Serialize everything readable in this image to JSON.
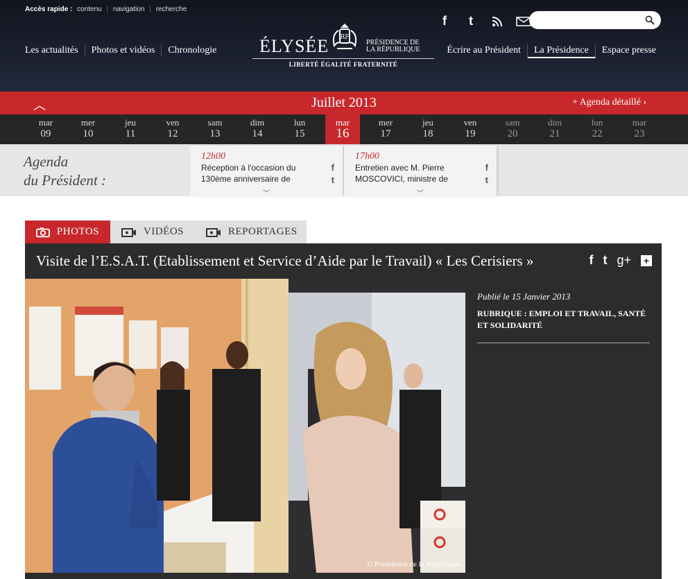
{
  "quick_access": {
    "label": "Accès rapide :",
    "links": [
      "contenu",
      "navigation",
      "recherche"
    ]
  },
  "nav_left": [
    "Les actualités",
    "Photos et vidéos",
    "Chronologie"
  ],
  "nav_right": [
    "Écrire au Président",
    "La Présidence",
    "Espace presse"
  ],
  "logo": {
    "name": "ÉLYSÉE",
    "subtitle_1": "PRÉSIDENCE DE",
    "subtitle_2": "LA RÉPUBLIQUE",
    "motto": "LIBERTÉ ÉGALITÉ FRATERNITÉ"
  },
  "social_top": [
    "facebook-icon",
    "twitter-icon",
    "rss-icon",
    "mail-icon"
  ],
  "search": {
    "value": "",
    "placeholder": ""
  },
  "calendar": {
    "month": "Juillet 2013",
    "agenda_link": "+ Agenda détaillé ›",
    "days": [
      {
        "name": "mar",
        "num": "09"
      },
      {
        "name": "mer",
        "num": "10"
      },
      {
        "name": "jeu",
        "num": "11"
      },
      {
        "name": "ven",
        "num": "12"
      },
      {
        "name": "sam",
        "num": "13"
      },
      {
        "name": "dim",
        "num": "14"
      },
      {
        "name": "lun",
        "num": "15"
      },
      {
        "name": "mar",
        "num": "16"
      },
      {
        "name": "mer",
        "num": "17"
      },
      {
        "name": "jeu",
        "num": "18"
      },
      {
        "name": "ven",
        "num": "19"
      },
      {
        "name": "sam",
        "num": "20"
      },
      {
        "name": "dim",
        "num": "21"
      },
      {
        "name": "lun",
        "num": "22"
      },
      {
        "name": "mar",
        "num": "23"
      }
    ],
    "active_index": 7
  },
  "agenda": {
    "title_line1": "Agenda",
    "title_line2": "du Président :",
    "events": [
      {
        "time": "12h00",
        "text": "Réception à l'occasion du 130ème anniversaire de"
      },
      {
        "time": "17h00",
        "text": "Entretien avec M. Pierre MOSCOVICI, ministre de"
      }
    ]
  },
  "tabs": [
    "PHOTOS",
    "VIDÉOS",
    "REPORTAGES"
  ],
  "article": {
    "title": "Visite de l’E.S.A.T. (Etablissement et Service d’Aide par le Travail) « Les Cerisiers »",
    "published": "Publié le 15 Janvier 2013",
    "rubrique": "RUBRIQUE : EMPLOI ET TRAVAIL, SANTÉ ET SOLIDARITÉ",
    "credit": "© Présidence de la République"
  },
  "colors": {
    "accent_red": "#c8282c",
    "header_dark": "#1b2030",
    "panel_dark": "#2c2c2c"
  }
}
